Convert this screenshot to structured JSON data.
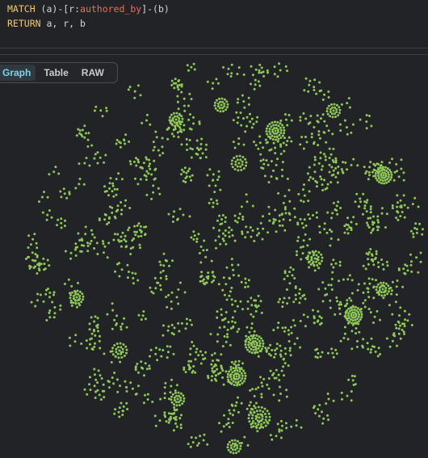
{
  "query": {
    "line1": {
      "keyword": "MATCH",
      "before": " (a)-[r:",
      "rel": "authored_by",
      "after": "]-(b)"
    },
    "line2": {
      "keyword": "RETURN",
      "rest": " a, r, b"
    }
  },
  "view_tabs": {
    "graph_label": "Graph",
    "table_label": "Table",
    "raw_label": "RAW",
    "active": "Graph"
  },
  "graph": {
    "node_color": "#8fc857",
    "background": "#222327"
  },
  "colors": {
    "keyword": "#f4c96b",
    "relationship_type": "#f06c5c",
    "code_text": "#d6d6d6",
    "active_tab": "#7fd3e6"
  }
}
